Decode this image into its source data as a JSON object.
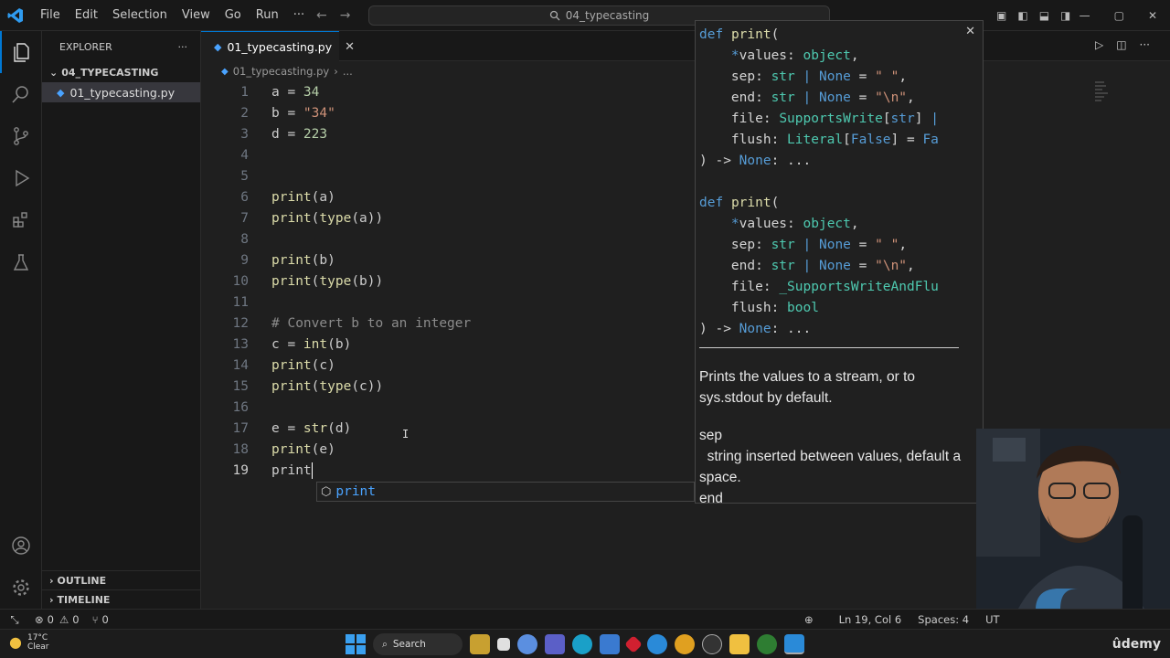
{
  "menu": [
    "File",
    "Edit",
    "Selection",
    "View",
    "Go",
    "Run",
    "···"
  ],
  "search": {
    "text": "04_typecasting"
  },
  "sidebar": {
    "title": "EXPLORER",
    "more": "···",
    "folder": "04_TYPECASTING",
    "file": "01_typecasting.py",
    "outline": "OUTLINE",
    "timeline": "TIMELINE"
  },
  "tab": {
    "label": "01_typecasting.py"
  },
  "breadcrumb": {
    "file": "01_typecasting.py",
    "more": "..."
  },
  "code": {
    "lines": [
      {
        "n": "1",
        "t": "a = 34"
      },
      {
        "n": "2",
        "t": "b = \"34\""
      },
      {
        "n": "3",
        "t": "d = 223"
      },
      {
        "n": "4",
        "t": ""
      },
      {
        "n": "5",
        "t": ""
      },
      {
        "n": "6",
        "t": "print(a)"
      },
      {
        "n": "7",
        "t": "print(type(a))"
      },
      {
        "n": "8",
        "t": ""
      },
      {
        "n": "9",
        "t": "print(b)"
      },
      {
        "n": "10",
        "t": "print(type(b))"
      },
      {
        "n": "11",
        "t": ""
      },
      {
        "n": "12",
        "t": "# Convert b to an integer"
      },
      {
        "n": "13",
        "t": "c = int(b)"
      },
      {
        "n": "14",
        "t": "print(c)"
      },
      {
        "n": "15",
        "t": "print(type(c))"
      },
      {
        "n": "16",
        "t": ""
      },
      {
        "n": "17",
        "t": "e = str(d)"
      },
      {
        "n": "18",
        "t": "print(e)"
      },
      {
        "n": "19",
        "t": "print"
      }
    ]
  },
  "suggest": {
    "label": "print"
  },
  "hover": {
    "sig1": [
      "def print(",
      "    *values: object,",
      "    sep: str | None = \" \",",
      "    end: str | None = \"\\n\",",
      "    file: SupportsWrite[str] |",
      "    flush: Literal[False] = Fa",
      ") -> None: ..."
    ],
    "sig2": [
      "def print(",
      "    *values: object,",
      "    sep: str | None = \" \",",
      "    end: str | None = \"\\n\",",
      "    file: _SupportsWriteAndFlu",
      "    flush: bool",
      ") -> None: ..."
    ],
    "doc1": "Prints the values to a stream, or to sys.stdout by default.",
    "param": "sep",
    "param_desc": "string inserted between values, default a space.",
    "param2": "end"
  },
  "status": {
    "errors": "0",
    "warnings": "0",
    "ports": "0",
    "position": "Ln 19, Col 6",
    "spaces": "Spaces: 4",
    "encoding": "UT"
  },
  "taskbar": {
    "temp": "17°C",
    "weather": "Clear",
    "search": "Search",
    "brand": "ûdemy"
  },
  "colors": {
    "accent": "#0078d4",
    "function": "#4aa3ff"
  }
}
